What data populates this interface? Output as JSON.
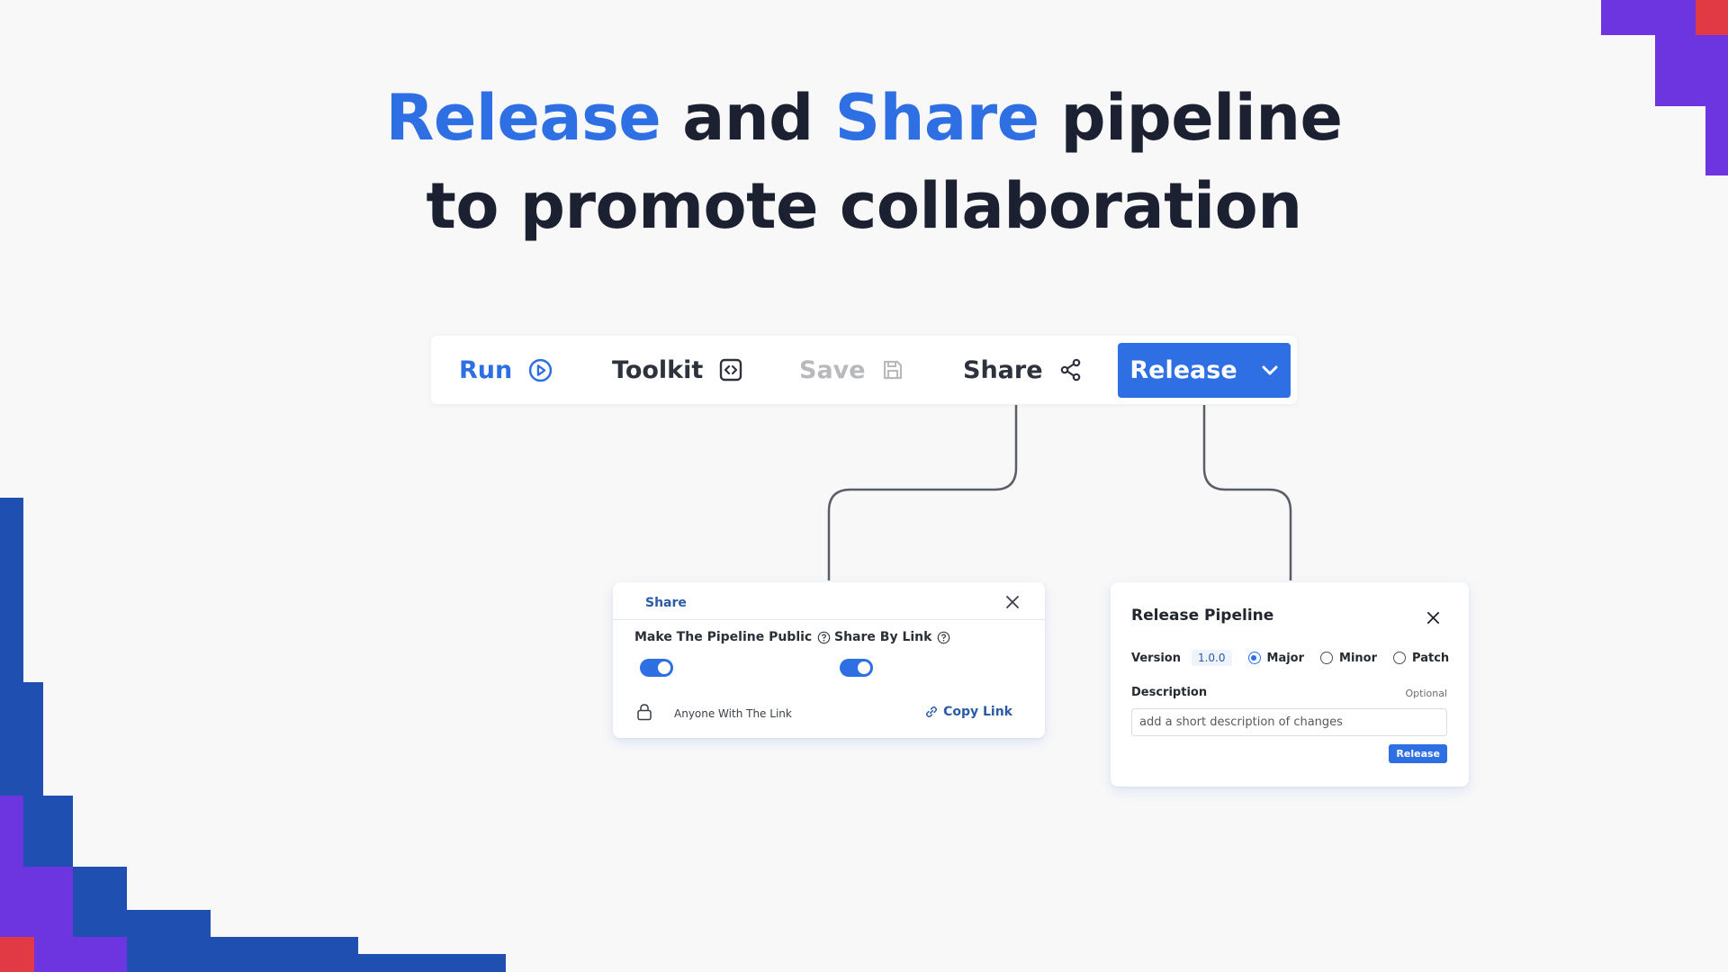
{
  "headline": {
    "line1": {
      "accent1": "Release",
      "mid": "and",
      "accent2": "Share",
      "tail": "pipeline"
    },
    "line2": "to promote collaboration"
  },
  "toolbar": {
    "run_label": "Run",
    "toolkit_label": "Toolkit",
    "save_label": "Save",
    "share_label": "Share",
    "release_label": "Release"
  },
  "share_panel": {
    "title": "Share",
    "public_label": "Make The Pipeline Public",
    "public_enabled": true,
    "link_label": "Share By Link",
    "link_enabled": true,
    "access_text": "Anyone With The Link",
    "copy_label": "Copy Link"
  },
  "release_panel": {
    "title": "Release Pipeline",
    "version_label": "Version",
    "version_value": "1.0.0",
    "options": [
      {
        "label": "Major",
        "selected": true
      },
      {
        "label": "Minor",
        "selected": false
      },
      {
        "label": "Patch",
        "selected": false
      }
    ],
    "description_label": "Description",
    "optional_label": "Optional",
    "description_placeholder": "add a short description of changes",
    "submit_label": "Release"
  },
  "colors": {
    "accent": "#2f6fe4",
    "background": "#f8f8f8",
    "decor_blue": "#1f4fb0",
    "decor_purple": "#6c35e0",
    "decor_red": "#e23a44"
  }
}
